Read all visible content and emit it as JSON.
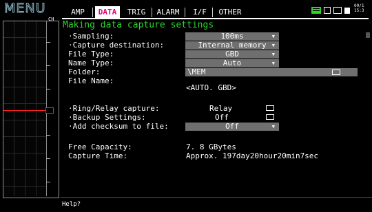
{
  "sidebar": {
    "title": "MENU",
    "channel_label": "CH"
  },
  "tabs": [
    {
      "label": "AMP",
      "active": false
    },
    {
      "label": "DATA",
      "active": true
    },
    {
      "label": "TRIG",
      "active": false
    },
    {
      "label": "ALARM",
      "active": false
    },
    {
      "label": "I/F",
      "active": false
    },
    {
      "label": "OTHER",
      "active": false
    }
  ],
  "status": {
    "date": "09/1",
    "time": "15:3"
  },
  "section_title": "Making data capture settings",
  "settings": {
    "sampling": {
      "label": "·Sampling:",
      "value": "100ms"
    },
    "capture_destination": {
      "label": "·Capture destination:",
      "value": "Internal memory"
    },
    "file_type": {
      "label": " File Type:",
      "value": "GBD"
    },
    "name_type": {
      "label": " Name Type:",
      "value": "Auto"
    },
    "folder": {
      "label": " Folder:",
      "value": "\\MEM"
    },
    "file_name": {
      "label": " File Name:",
      "value": "<AUTO. GBD>"
    },
    "ring_relay": {
      "label": "·Ring/Relay capture:",
      "value": "Relay"
    },
    "backup": {
      "label": "·Backup Settings:",
      "value": "Off"
    },
    "checksum": {
      "label": "·Add checksum to file:",
      "value": "Off"
    },
    "free_capacity": {
      "label": " Free Capacity:",
      "value": "7. 8 GBytes"
    },
    "capture_time": {
      "label": " Capture Time:",
      "value": "Approx. 197day20hour20min7sec"
    }
  },
  "help": "Help?",
  "colors": {
    "accent_green": "#2bd62b",
    "active_tab_text": "#e0007a",
    "field_bg": "#6f6f6f",
    "trace_red": "#ff2020"
  }
}
